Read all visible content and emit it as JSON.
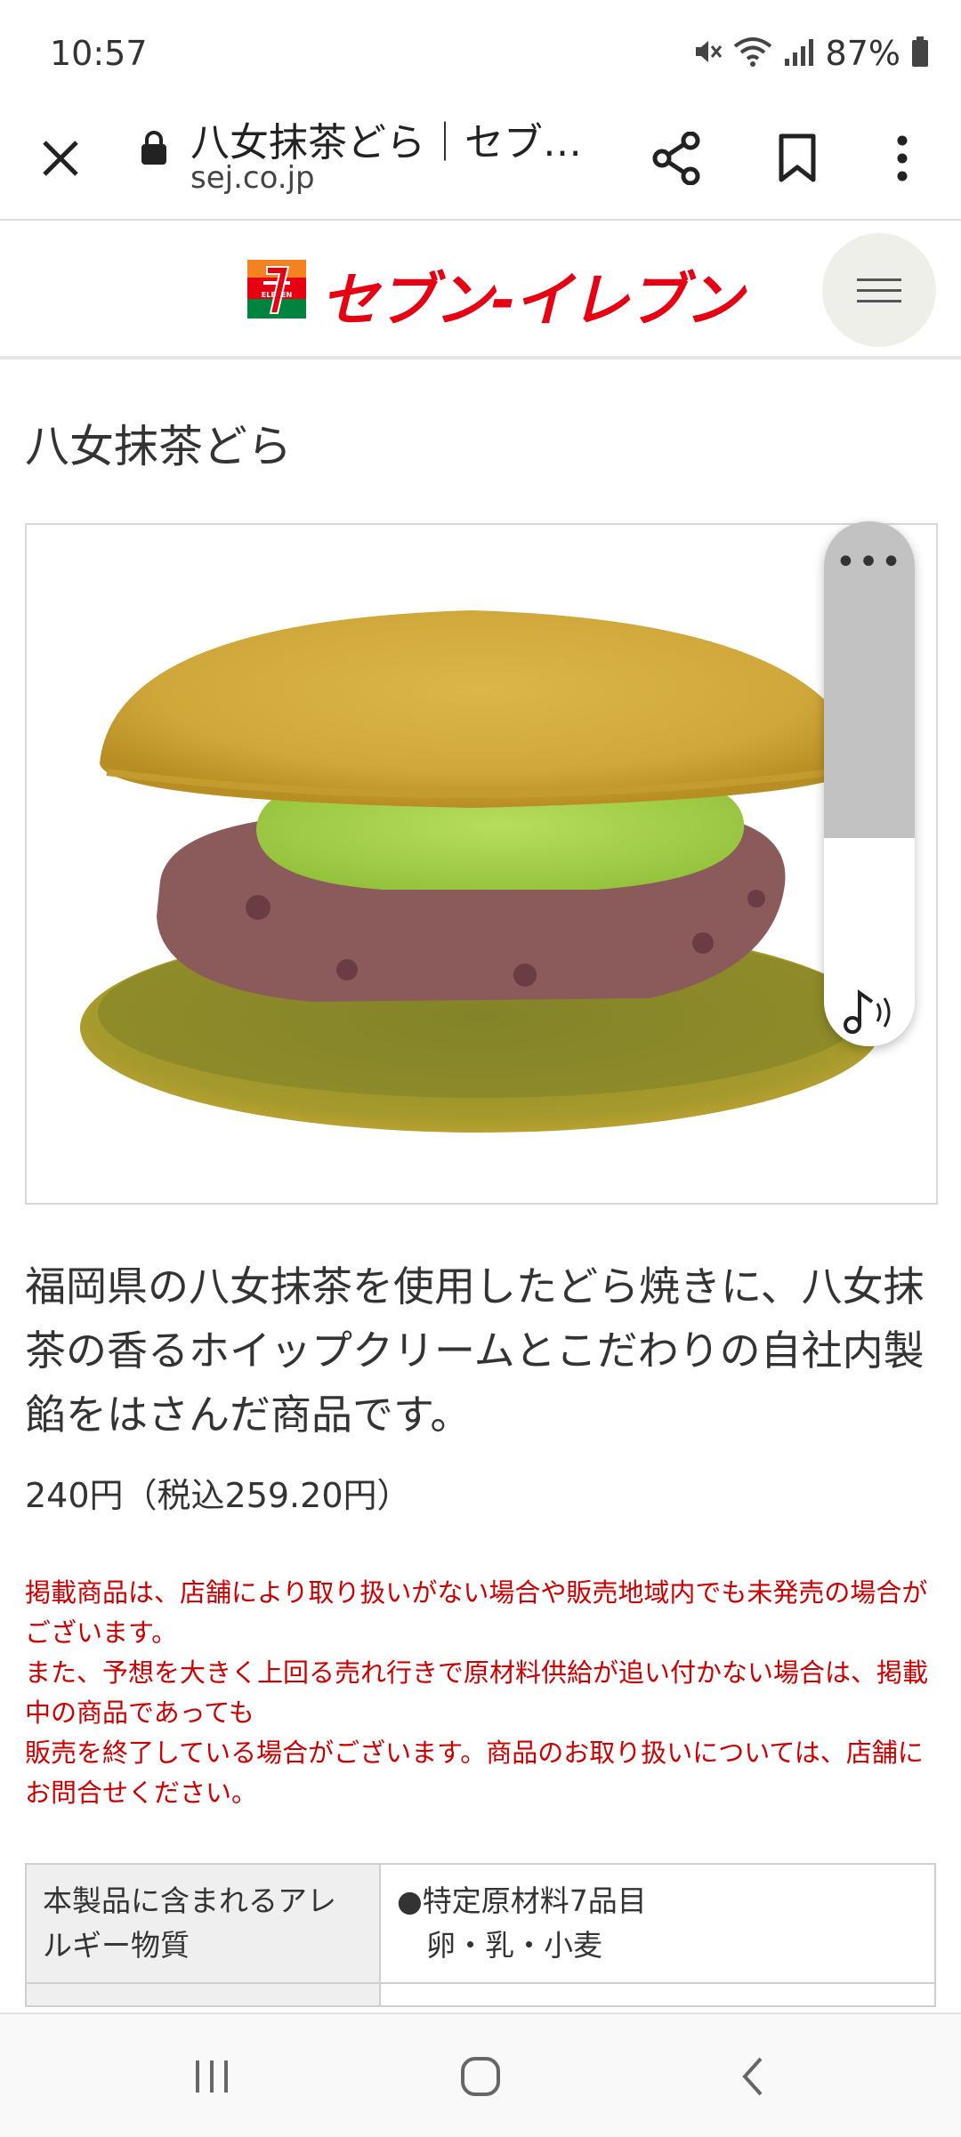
{
  "status": {
    "time": "10:57",
    "battery": "87%"
  },
  "browser": {
    "tab_title": "八女抹茶どら｜セブン‐イレブン",
    "url": "sej.co.jp"
  },
  "site": {
    "logo_text": "セブン‐イレブン",
    "logo_badge": "ELEVEN"
  },
  "product": {
    "title": "八女抹茶どら",
    "description": "福岡県の八女抹茶を使用したどら焼きに、八女抹茶の香るホイップクリームとこだわりの自社内製餡をはさんだ商品です。",
    "price": "240円（税込259.20円）"
  },
  "notice": {
    "line1": "掲載商品は、店舗により取り扱いがない場合や販売地域内でも未発売の場合がございます。",
    "line2": "また、予想を大きく上回る売れ行きで原材料供給が追い付かない場合は、掲載中の商品であっても",
    "line3": "販売を終了している場合がございます。商品のお取り扱いについては、店舗にお問合せください。"
  },
  "allergy": {
    "header": "本製品に含まれるアレルギー物質",
    "line1": "●特定原材料7品目",
    "line2": "　卵・乳・小麦"
  },
  "floating_panel": {
    "more_label": "•••"
  },
  "colors": {
    "brand_red": "#e60012",
    "brand_green": "#00843d",
    "brand_orange": "#f58220",
    "notice_red": "#cc0000"
  }
}
